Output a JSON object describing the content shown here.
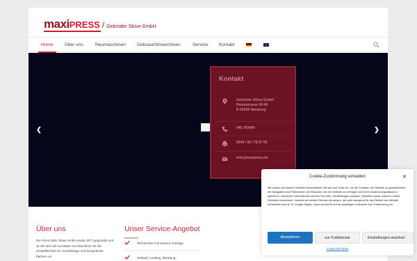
{
  "brand": {
    "logo_maxi": "maxi",
    "logo_press": "PRESS",
    "company": "Gebrüder Stüve GmbH"
  },
  "nav": {
    "items": [
      "Home",
      "Über uns",
      "Neumaschinen",
      "Gebrauchtmaschinen",
      "Service",
      "Kontakt"
    ],
    "active": "Home",
    "languages": [
      "de-flag",
      "gb-flag"
    ]
  },
  "slider": {
    "contact": {
      "title": "Kontakt",
      "address": [
        "Gebrüder Stüve GmbH",
        "Peutestrasse 43-45",
        "D-20539 Hamburg"
      ],
      "phone": "040-783484",
      "fax": "0049 / 40 / 78 57 95",
      "email": "info@maxipress.de"
    }
  },
  "about": {
    "heading": "Über uns",
    "text": "Die Firma Gebr. Stüve GmbH wurde 1977 gegründet und ist seit dem als Ausstatter von Maschinen für die Umwelttechnik ein zuverlässiger und kompetenter Partner von"
  },
  "service": {
    "heading": "Unser Service-Angebot",
    "items": [
      "Technische Full Service Verträge",
      "Verkauf, Leasing, Beratung,"
    ]
  },
  "cookie": {
    "title": "Cookie-Zustimmung verwalten",
    "text": "Wir setzen auf unserer Website verschiedene Dienste und Tools ein, um die Funktion der Website zu gewährleisten, die Navigation und Präferenzen der Besucher auf der Website zu verfolgen und Ihren Zustimmungsstatus zu speichern. Genauere Informationen können Sie unter „Einstellungen ansehen“ einsehen sowie unserer Cookie-Richtlinie entnehmen. Insoweit wir weitere Dienste ein-setzen, die nicht zwingend für den Betrieb der Website erforderlich sind (z. B. Google Maps), holen wir hierfür auf der jeweiligen Unterseite Ihre Zustimmung ein.",
    "accept": "Akzeptieren",
    "functional": "nur Funktionale",
    "preferences": "Einstellungen ansehen",
    "policy_link": "Cookie-Richtlinie"
  },
  "colors": {
    "brand_red": "#d31c2b",
    "contact_bg": "#6b1224",
    "accept_blue": "#1e73be"
  }
}
